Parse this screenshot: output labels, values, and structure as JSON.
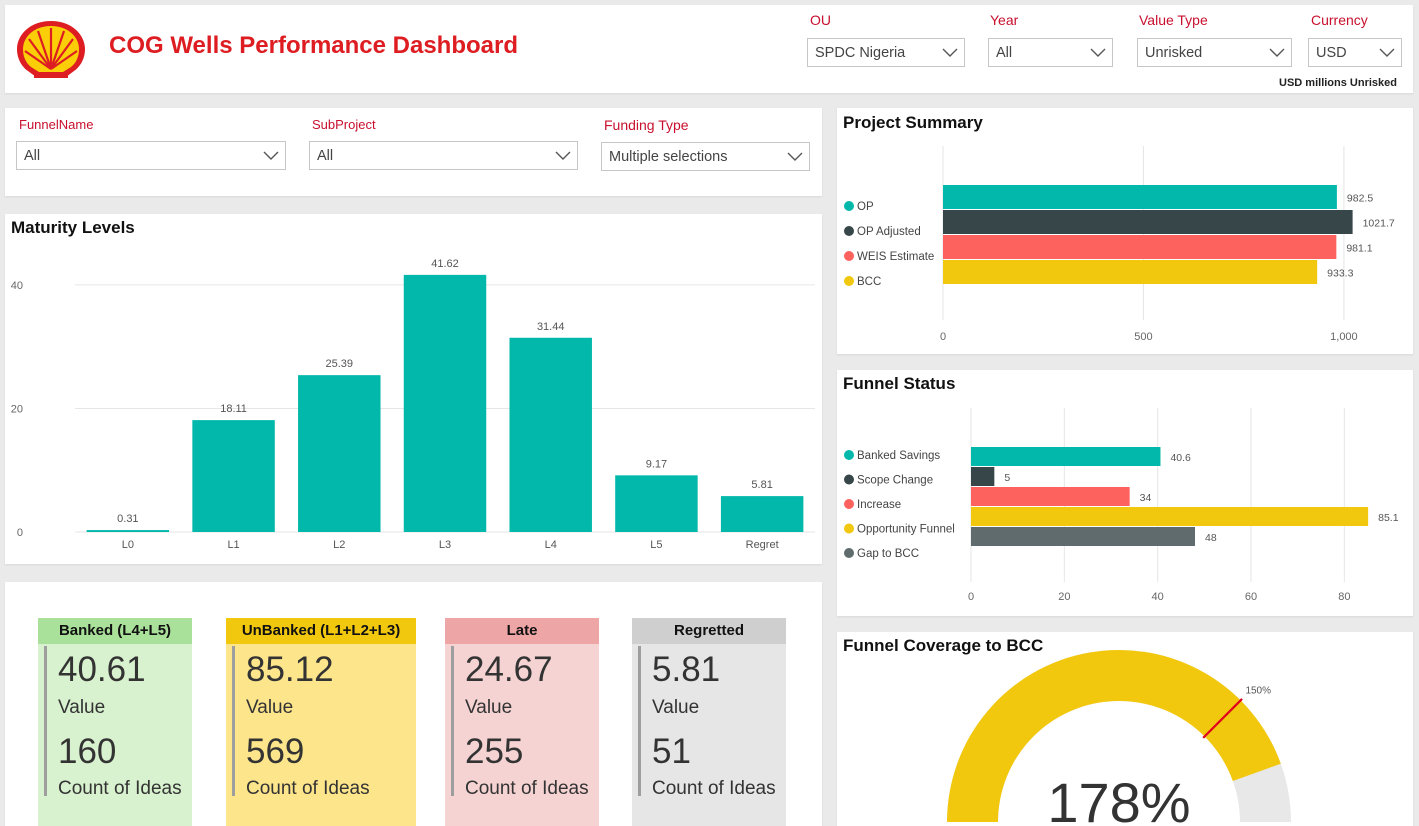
{
  "header": {
    "title": "COG Wells Performance Dashboard",
    "logo": "shell-pecten-logo",
    "units_note": "USD millions Unrisked",
    "slicers": [
      {
        "label": "OU",
        "value": "SPDC Nigeria"
      },
      {
        "label": "Year",
        "value": "All"
      },
      {
        "label": "Value Type",
        "value": "Unrisked"
      },
      {
        "label": "Currency",
        "value": "USD"
      }
    ]
  },
  "filters": {
    "slicers": [
      {
        "label": "FunnelName",
        "value": "All"
      },
      {
        "label": "SubProject",
        "value": "All"
      },
      {
        "label": "Funding Type",
        "value": "Multiple selections"
      }
    ]
  },
  "maturity": {
    "title": "Maturity Levels"
  },
  "project_summary": {
    "title": "Project Summary"
  },
  "funnel_status": {
    "title": "Funnel Status"
  },
  "coverage": {
    "title": "Funnel Coverage to BCC",
    "value_label": "178%",
    "target_label": "150%"
  },
  "cards": [
    {
      "title": "Banked (L4+L5)",
      "value": "40.61",
      "value_label": "Value",
      "count": "160",
      "count_label": "Count of Ideas",
      "head_color": "#a9e19a",
      "body_color": "#d8f1ce"
    },
    {
      "title": "UnBanked (L1+L2+L3)",
      "value": "85.12",
      "value_label": "Value",
      "count": "569",
      "count_label": "Count of Ideas",
      "head_color": "#f2c80f",
      "body_color": "#fde58c"
    },
    {
      "title": "Late",
      "value": "24.67",
      "value_label": "Value",
      "count": "255",
      "count_label": "Count of Ideas",
      "head_color": "#eea5a6",
      "body_color": "#f6d3d3"
    },
    {
      "title": "Regretted",
      "value": "5.81",
      "value_label": "Value",
      "count": "51",
      "count_label": "Count of Ideas",
      "head_color": "#cfcfcf",
      "body_color": "#e6e6e6"
    }
  ],
  "colors": {
    "teal": "#01b8aa",
    "dark": "#374649",
    "red": "#fd625e",
    "yellow": "#f2c80f",
    "grey": "#5f6b6d",
    "brand_red": "#dd1d21"
  },
  "chart_data": [
    {
      "type": "bar",
      "title": "Maturity Levels",
      "categories": [
        "L0",
        "L1",
        "L2",
        "L3",
        "L4",
        "L5",
        "Regret"
      ],
      "values": [
        0.31,
        18.11,
        25.39,
        41.62,
        31.44,
        9.17,
        5.81
      ],
      "data_labels": [
        "0.31",
        "18.11",
        "25.39",
        "41.62",
        "31.44",
        "9.17",
        "5.81"
      ],
      "yticks": [
        0,
        20,
        40
      ],
      "ylim": [
        0,
        45
      ],
      "grid": true
    },
    {
      "type": "bar",
      "orientation": "horizontal",
      "title": "Project Summary",
      "categories": [
        "OP",
        "OP Adjusted",
        "WEIS Estimate",
        "BCC"
      ],
      "values": [
        982.5,
        1021.7,
        981.1,
        933.3
      ],
      "data_labels": [
        "982.5",
        "1021.7",
        "981.1",
        "933.3"
      ],
      "colors": [
        "#01b8aa",
        "#374649",
        "#fd625e",
        "#f2c80f"
      ],
      "xticks": [
        0,
        500,
        1000
      ],
      "xtick_labels": [
        "0",
        "500",
        "1,000"
      ],
      "xlim": [
        0,
        1100
      ],
      "legend": "left",
      "grid": true
    },
    {
      "type": "bar",
      "orientation": "horizontal",
      "title": "Funnel Status",
      "categories": [
        "Banked Savings",
        "Scope Change",
        "Increase",
        "Opportunity Funnel",
        "Gap to BCC"
      ],
      "values": [
        40.6,
        5,
        34,
        85.1,
        48
      ],
      "data_labels": [
        "40.6",
        "5",
        "34",
        "85.1",
        "48"
      ],
      "colors": [
        "#01b8aa",
        "#374649",
        "#fd625e",
        "#f2c80f",
        "#5f6b6d"
      ],
      "xticks": [
        0,
        20,
        40,
        60,
        80
      ],
      "xlim": [
        0,
        90
      ],
      "legend": "left",
      "grid": true
    },
    {
      "type": "gauge",
      "title": "Funnel Coverage to BCC",
      "value": 178,
      "target": 150,
      "max": 200,
      "unit": "%"
    }
  ]
}
